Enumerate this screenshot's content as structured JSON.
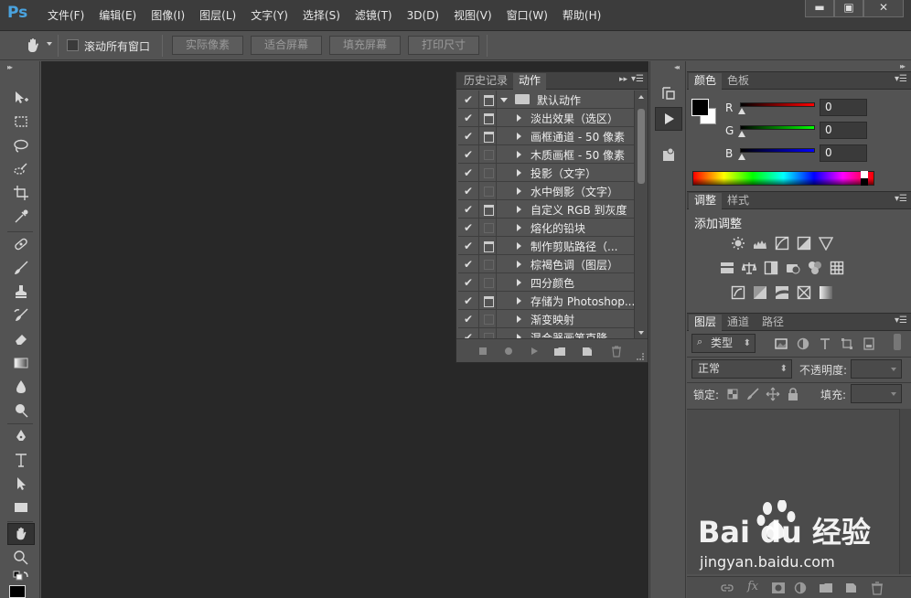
{
  "app": {
    "logo": "Ps",
    "menus": [
      "文件(F)",
      "编辑(E)",
      "图像(I)",
      "图层(L)",
      "文字(Y)",
      "选择(S)",
      "滤镜(T)",
      "3D(D)",
      "视图(V)",
      "窗口(W)",
      "帮助(H)"
    ],
    "window_controls": {
      "minimize": "▬",
      "maximize": "▣",
      "close": "✕"
    }
  },
  "options_bar": {
    "tool_icon": "hand-icon",
    "scroll_all_label": "滚动所有窗口",
    "scroll_all_checked": false,
    "buttons": [
      "实际像素",
      "适合屏幕",
      "填充屏幕",
      "打印尺寸"
    ]
  },
  "tools": [
    "move-tool-icon",
    "marquee-tool-icon",
    "lasso-tool-icon",
    "quick-select-tool-icon",
    "crop-tool-icon",
    "eyedropper-tool-icon",
    "healing-brush-tool-icon",
    "brush-tool-icon",
    "clone-stamp-tool-icon",
    "history-brush-tool-icon",
    "eraser-tool-icon",
    "gradient-tool-icon",
    "blur-tool-icon",
    "dodge-tool-icon",
    "pen-tool-icon",
    "type-tool-icon",
    "path-select-tool-icon",
    "rectangle-tool-icon",
    "hand-tool-icon",
    "zoom-tool-icon"
  ],
  "actions_panel": {
    "tabs": [
      "历史记录",
      "动作"
    ],
    "active_tab": "动作",
    "set_name": "默认动作",
    "actions": [
      {
        "label": "淡出效果（选区）",
        "dialog": true
      },
      {
        "label": "画框通道 - 50 像素",
        "dialog": true
      },
      {
        "label": "木质画框 - 50 像素",
        "dialog": false
      },
      {
        "label": "投影（文字）",
        "dialog": false
      },
      {
        "label": "水中倒影（文字）",
        "dialog": false
      },
      {
        "label": "自定义 RGB 到灰度",
        "dialog": true
      },
      {
        "label": "熔化的铅块",
        "dialog": false
      },
      {
        "label": "制作剪贴路径（...",
        "dialog": true
      },
      {
        "label": "棕褐色调（图层）",
        "dialog": false
      },
      {
        "label": "四分颜色",
        "dialog": false
      },
      {
        "label": "存储为 Photoshop...",
        "dialog": true
      },
      {
        "label": "渐变映射",
        "dialog": false
      },
      {
        "label": "混合器画笔克隆...",
        "dialog": false
      }
    ],
    "footer_icons": [
      "stop-icon",
      "record-icon",
      "play-icon",
      "new-set-icon",
      "new-action-icon",
      "delete-icon"
    ]
  },
  "color_panel": {
    "tabs": [
      "颜色",
      "色板"
    ],
    "channels": [
      {
        "name": "R",
        "value": "0",
        "color": "#ff0000"
      },
      {
        "name": "G",
        "value": "0",
        "color": "#00ff00"
      },
      {
        "name": "B",
        "value": "0",
        "color": "#0000ff"
      }
    ],
    "foreground": "#000000",
    "background": "#ffffff"
  },
  "adjustments_panel": {
    "tabs": [
      "调整",
      "样式"
    ],
    "title": "添加调整"
  },
  "layers_panel": {
    "tabs": [
      "图层",
      "通道",
      "路径"
    ],
    "filter_kind": "类型",
    "blend_mode": "正常",
    "opacity_label": "不透明度:",
    "lock_label": "锁定:",
    "fill_label": "填充:"
  },
  "watermark": {
    "brand": "Bai du 经验",
    "url": "jingyan.baidu.com"
  }
}
